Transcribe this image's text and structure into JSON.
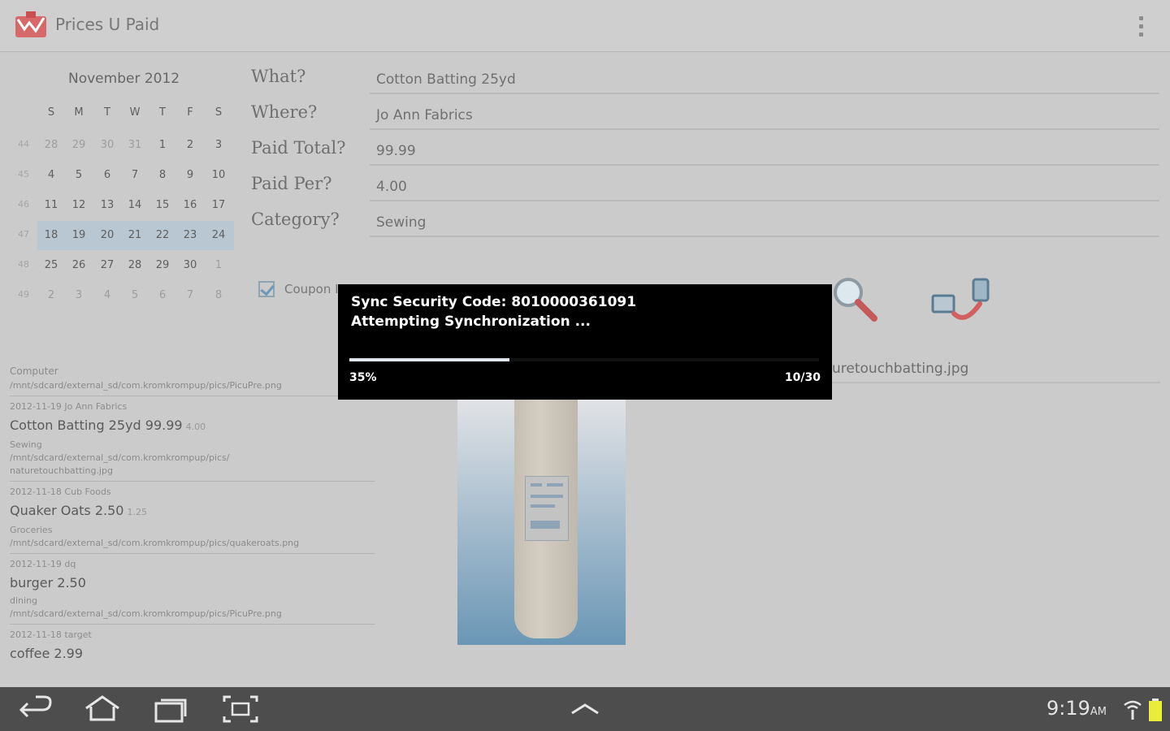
{
  "app": {
    "title": "Prices U Paid"
  },
  "calendar": {
    "month": "November 2012",
    "weekdays": [
      "S",
      "M",
      "T",
      "W",
      "T",
      "F",
      "S"
    ],
    "weeks": [
      {
        "num": "44",
        "days": [
          "28",
          "29",
          "30",
          "31",
          "1",
          "2",
          "3"
        ]
      },
      {
        "num": "45",
        "days": [
          "4",
          "5",
          "6",
          "7",
          "8",
          "9",
          "10"
        ]
      },
      {
        "num": "46",
        "days": [
          "11",
          "12",
          "13",
          "14",
          "15",
          "16",
          "17"
        ]
      },
      {
        "num": "47",
        "days": [
          "18",
          "19",
          "20",
          "21",
          "22",
          "23",
          "24"
        ]
      },
      {
        "num": "48",
        "days": [
          "25",
          "26",
          "27",
          "28",
          "29",
          "30",
          "1"
        ]
      },
      {
        "num": "49",
        "days": [
          "2",
          "3",
          "4",
          "5",
          "6",
          "7",
          "8"
        ]
      }
    ]
  },
  "form": {
    "what_label": "What?",
    "what_value": "Cotton Batting 25yd",
    "where_label": "Where?",
    "where_value": "Jo Ann Fabrics",
    "total_label": "Paid Total?",
    "total_value": "99.99",
    "per_label": "Paid Per?",
    "per_value": "4.00",
    "category_label": "Category?",
    "category_value": "Sewing",
    "coupon_label": "Coupon I",
    "filename": "uretouchbatting.jpg"
  },
  "list": {
    "header": "Computer",
    "header_path": "/mnt/sdcard/external_sd/com.kromkrompup/pics/PicuPre.png",
    "items": [
      {
        "date": "2012-11-19   Jo Ann Fabrics",
        "name": "Cotton Batting 25yd",
        "price": "99.99",
        "per": "4.00",
        "category": "Sewing",
        "path1": "/mnt/sdcard/external_sd/com.kromkrompup/pics/",
        "path2": "naturetouchbatting.jpg"
      },
      {
        "date": "2012-11-18   Cub Foods",
        "name": "Quaker Oats",
        "price": "2.50",
        "per": "1.25",
        "category": "Groceries",
        "path1": "/mnt/sdcard/external_sd/com.kromkrompup/pics/quakeroats.png",
        "path2": ""
      },
      {
        "date": "2012-11-19   dq",
        "name": "burger",
        "price": "2.50",
        "per": "",
        "category": "dining",
        "path1": "/mnt/sdcard/external_sd/com.kromkrompup/pics/PicuPre.png",
        "path2": ""
      },
      {
        "date": "2012-11-18   target",
        "name": "coffee",
        "price": "2.99",
        "per": "",
        "category": "",
        "path1": "",
        "path2": ""
      }
    ]
  },
  "dialog": {
    "line1": "Sync Security Code: 8010000361091",
    "line2": "Attempting Synchronization ...",
    "percent_label": "35%",
    "progress": 0.34,
    "count": "10/30"
  },
  "status": {
    "time": "9:19",
    "ampm": "AM"
  },
  "colors": {
    "dialog_bg": "#000000",
    "progress_fill": "#dfe7ee",
    "calendar_selected": "#b8c7d2",
    "navbar": "#4d4d4d"
  }
}
